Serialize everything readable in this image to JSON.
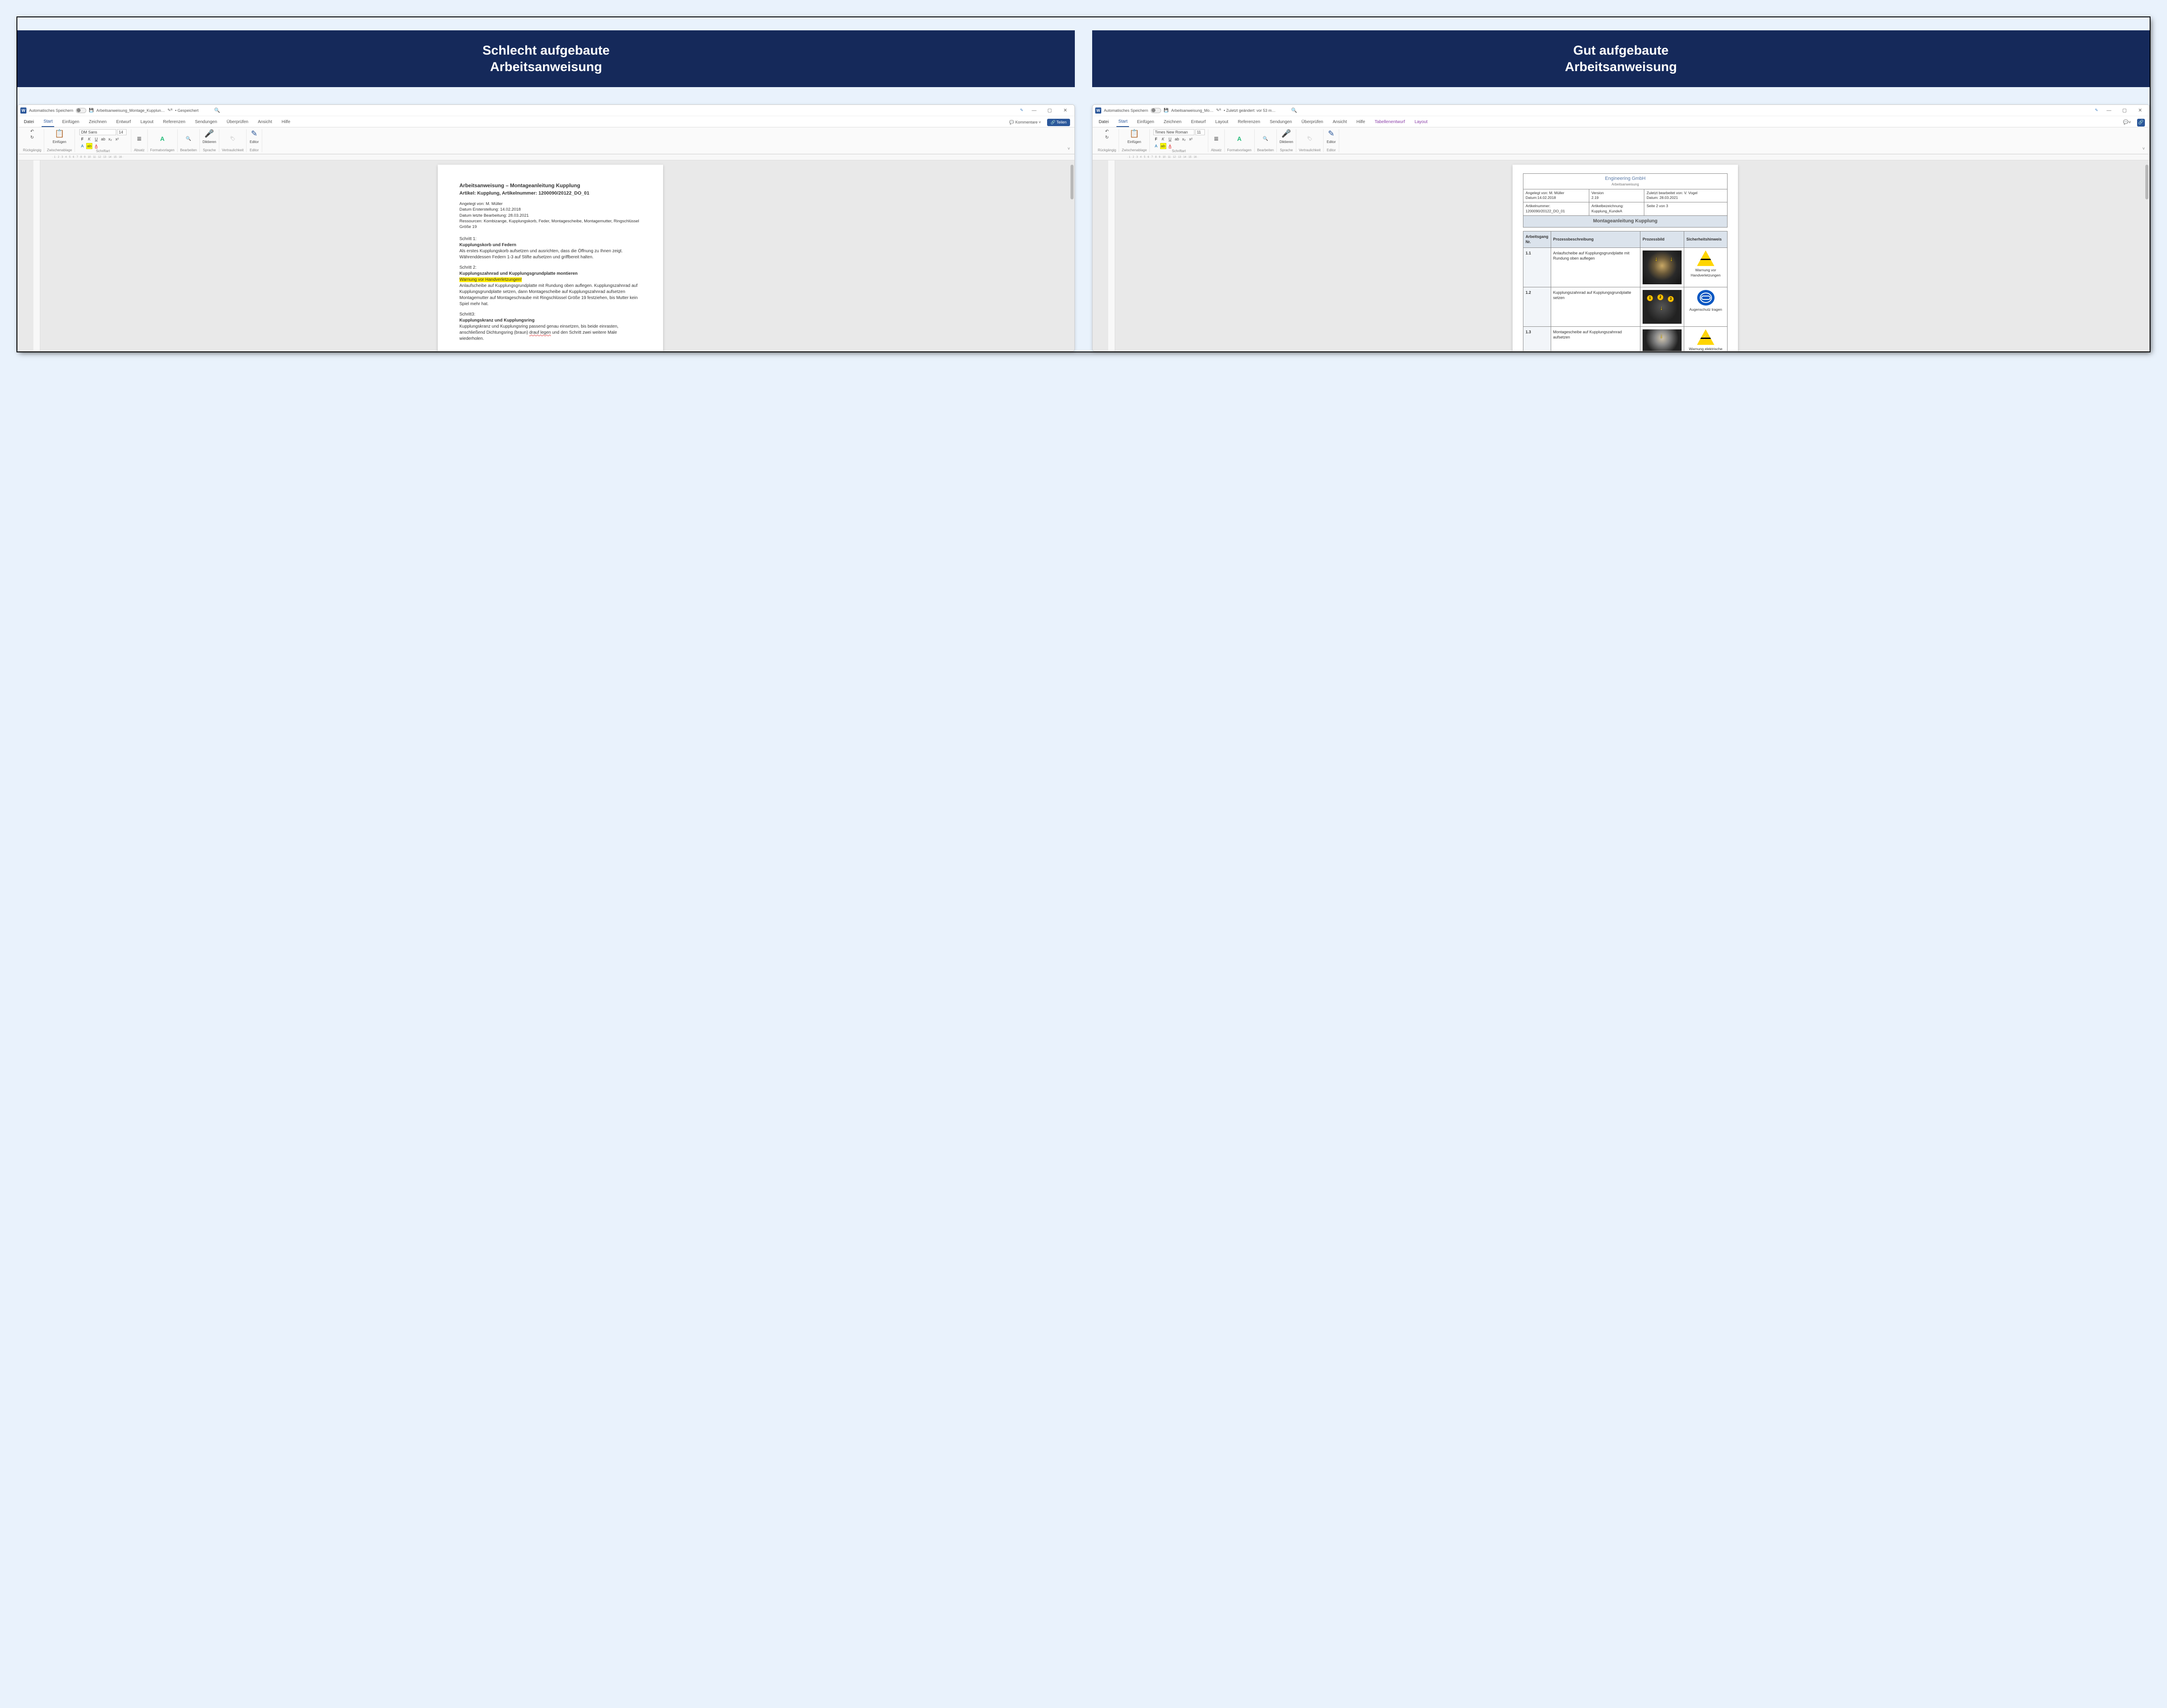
{
  "left": {
    "banner": "Schlecht aufgebaute\nArbeitsanweisung",
    "titlebar": {
      "autosave": "Automatisches Speichern",
      "filename": "Arbeitsanweisung_Montage_Kupplun…",
      "saved": "• Gespeichert"
    },
    "tabs": {
      "file": "Datei",
      "start": "Start",
      "insert": "Einfügen",
      "draw": "Zeichnen",
      "design": "Entwurf",
      "layout": "Layout",
      "refs": "Referenzen",
      "mail": "Sendungen",
      "review": "Überprüfen",
      "view": "Ansicht",
      "help": "Hilfe",
      "comments": "Kommentare",
      "share": "Teilen"
    },
    "ribbon": {
      "undo": "Rückgängig",
      "clipboard": "Zwischenablage",
      "paste": "Einfügen",
      "fontname": "DM Sans",
      "fontsize": "14",
      "fontgrp": "Schriftart",
      "paragraph": "Absatz",
      "styles": "Formatvorlagen",
      "edit": "Bearbeiten",
      "dictate": "Diktieren",
      "speech": "Sprache",
      "sensitivity": "Vertraulichkeit",
      "editor": "Editor"
    },
    "doc": {
      "title": "Arbeitsanweisung – Montageanleitung Kupplung",
      "subtitle": "Artikel: Kupplung, Artikelnummer: 1200090/20122_DO_01",
      "meta1": "Angelegt von: M. Müller",
      "meta2": "Datum Ersterstellung: 14.02.2018",
      "meta3": "Datum letzte Bearbeitung: 28.03.2021",
      "meta4": "Ressourcen: Kombizange, Kupplungskorb, Feder, Montagescheibe, Montagemutter, Ringschlüssel Größe 19",
      "s1l": "Schritt 1:",
      "s1h": "Kupplungskorb und Federn",
      "s1t": "Als erstes Kupplungskorb aufsetzen und ausrichten, dass die Öffnung zu Ihnen zeigt. Währenddessen Federn 1-3 auf Stifte aufsetzen und griffbereit halten.",
      "s2l": "Schritt 2:",
      "s2h": "Kupplungszahnrad und Kupplungsgrundplatte montieren",
      "s2w": "Warnung vor Handverletzungen!",
      "s2t1": "Anlaufscheibe auf Kupplungsgrundplatte mit Rundung oben auflegen. Kupplungszahnrad auf Kupplungsgrundplatte setzen, dann Montagescheibe auf Kupplungszahnrad aufsetzen",
      "s2t2": "Montagemutter auf Montageschraube mit Ringschlüssel Größe 19 festziehen, bis Mutter kein Spiel mehr hat.",
      "s3l": "Schritt3:",
      "s3h": "Kupplungskranz und Kupplungsring",
      "s3t_a": "Kupplungskranz und Kupplungsring passend genau einsetzen, bis beide einrasten, anschließend Dichtungsring (braun) ",
      "s3t_wavy": "drauf legen",
      "s3t_b": " und den Schritt zwei weitere Male wiederholen."
    }
  },
  "right": {
    "banner": "Gut aufgebaute\nArbeitsanweisung",
    "titlebar": {
      "autosave": "Automatisches Speichern",
      "filename": "Arbeitsanweisung_Mo…",
      "saved": "• Zuletzt geändert: vor 53 m…"
    },
    "tabs": {
      "file": "Datei",
      "start": "Start",
      "insert": "Einfügen",
      "draw": "Zeichnen",
      "design": "Entwurf",
      "layout": "Layout",
      "refs": "Referenzen",
      "mail": "Sendungen",
      "review": "Überprüfen",
      "view": "Ansicht",
      "help": "Hilfe",
      "tbldesign": "Tabellenentwurf",
      "tbllayout": "Layout"
    },
    "ribbon": {
      "undo": "Rückgängig",
      "clipboard": "Zwischenablage",
      "paste": "Einfügen",
      "fontname": "Times New Roman",
      "fontsize": "11",
      "fontgrp": "Schriftart",
      "paragraph": "Absatz",
      "styles": "Formatvorlagen",
      "edit": "Bearbeiten",
      "dictate": "Diktieren",
      "speech": "Sprache",
      "sensitivity": "Vertraulichkeit",
      "editor": "Editor"
    },
    "hdr": {
      "company": "Engineering GmbH",
      "sub": "Arbeitsanweisung",
      "c1a": "Angelegt von: M. Müller",
      "c1b": "Datum:14.02.2018",
      "c2a": "Version",
      "c2b": "2.19",
      "c3a": "Zuletzt bearbeitet von: V. Vogel",
      "c3b": "Datum: 28.03.2021",
      "c4a": "Artikelnummer:",
      "c4b": "1200090/20122_DO_01",
      "c5a": "Artikelbezeichnung:",
      "c5b": "Kupplung_KundeA",
      "c6": "Seite 2 von 3",
      "title": "Montageanleitung Kupplung"
    },
    "table": {
      "h1": "Arbeitsgang Nr.",
      "h2": "Prozessbeschreibung",
      "h3": "Prozessbild",
      "h4": "Sicherheitshinweis",
      "r1n": "1.1",
      "r1d": "Anlaufscheibe auf Kupplungsgrundplatte mit Rundung oben auflegen",
      "r1s": "Warnung vor Handverletzungen",
      "r2n": "1.2",
      "r2d": "Kupplungszahnrad auf Kupplungsgrundplatte setzen",
      "r2s": "Augenschutz tragen",
      "r3n": "1.3",
      "r3d": "Montagescheibe auf Kupplungszahnrad aufsetzen",
      "r3s": "Warnung elektrische"
    }
  }
}
